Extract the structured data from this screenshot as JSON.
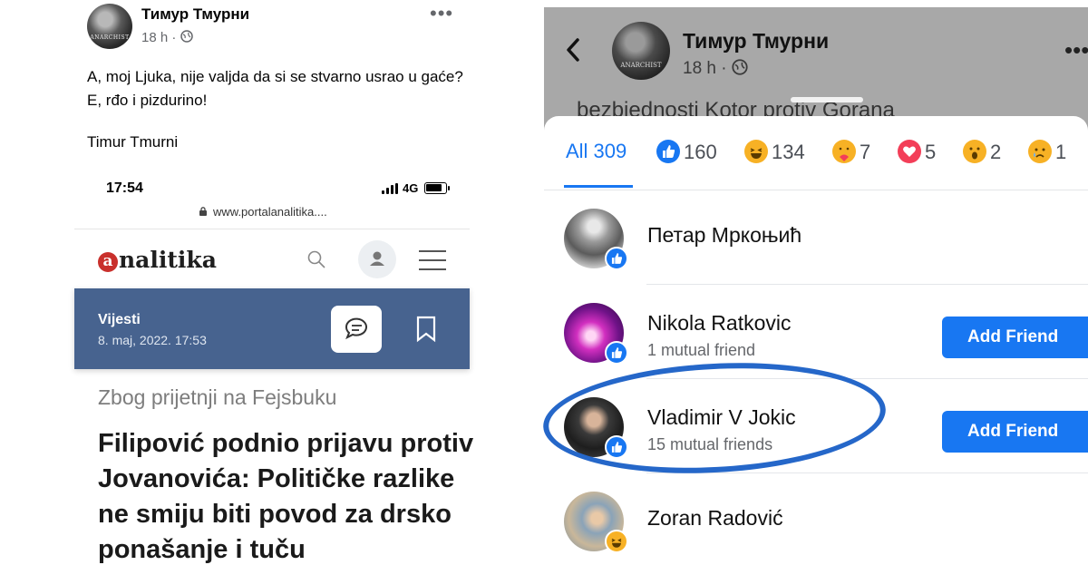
{
  "left": {
    "post": {
      "author": "Тимур Тмурни",
      "time": "18 h ·",
      "text": "A, moj Ljuka, nije valjda da si se stvarno usrao u gaće? E, rđo i pizdurino!",
      "signature": "Timur Tmurni",
      "more": "•••"
    },
    "avatar_text": "ANARCHIST",
    "status_bar": {
      "time": "17:54",
      "network": "4G"
    },
    "url": "www.portalanalitika....",
    "site": {
      "logo_initial": "a",
      "logo_rest": "nalitika",
      "category": "Vijesti",
      "date": "8. maj, 2022. 17:53",
      "kicker": "Zbog prijetnji na Fejsbuku",
      "headline": "Filipović podnio prijavu protiv Jovanovića: Političke razlike ne smiju biti povod za drsko ponašanje i tuču"
    }
  },
  "right": {
    "header": {
      "author": "Тимур Тмурни",
      "time": "18 h ·",
      "behind_text": "bezbjednosti Kotor protiv Gorana",
      "more": "•••",
      "avatar_text": "ANARCHIST"
    },
    "tabs": [
      {
        "label": "All 309",
        "icon": ""
      },
      {
        "label": "160",
        "icon": "like-icon",
        "color": "#1877f2"
      },
      {
        "label": "134",
        "icon": "haha-icon",
        "color": "#f7b125"
      },
      {
        "label": "7",
        "icon": "care-icon",
        "color": "#f7b125"
      },
      {
        "label": "5",
        "icon": "love-icon",
        "color": "#f33e58"
      },
      {
        "label": "2",
        "icon": "wow-icon",
        "color": "#f7b125"
      },
      {
        "label": "1",
        "icon": "sad-icon",
        "color": "#f7b125"
      }
    ],
    "people": [
      {
        "name": "Петар Мркоњић",
        "mutual": "",
        "button": "",
        "reaction": "like-icon"
      },
      {
        "name": "Nikola Ratkovic",
        "mutual": "1 mutual friend",
        "button": "Add Friend",
        "reaction": "like-icon"
      },
      {
        "name": "Vladimir V Jokic",
        "mutual": "15 mutual friends",
        "button": "Add Friend",
        "reaction": "like-icon"
      },
      {
        "name": "Zoran Radović",
        "mutual": "",
        "button": "",
        "reaction": "haha-icon"
      }
    ],
    "highlight_color": "#2567c9",
    "accent": "#1877f2"
  }
}
